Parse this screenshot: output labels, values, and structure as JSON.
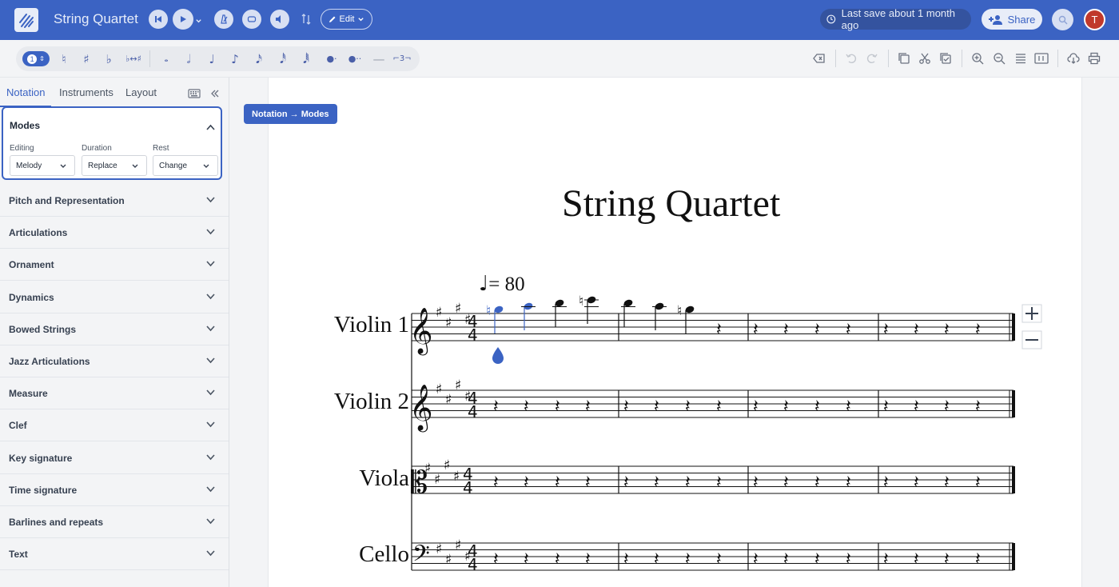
{
  "app": {
    "title": "String Quartet"
  },
  "header": {
    "edit_label": "Edit",
    "save_status": "Last save about 1 month ago",
    "share_label": "Share",
    "avatar_initial": "T"
  },
  "toolbar": {
    "voice_label": "1"
  },
  "sidebar": {
    "tabs": [
      {
        "label": "Notation"
      },
      {
        "label": "Instruments"
      },
      {
        "label": "Layout"
      }
    ],
    "modes": {
      "title": "Modes",
      "editing": {
        "label": "Editing",
        "value": "Melody"
      },
      "duration": {
        "label": "Duration",
        "value": "Replace"
      },
      "rest": {
        "label": "Rest",
        "value": "Change"
      }
    },
    "sections": [
      {
        "label": "Pitch and Representation"
      },
      {
        "label": "Articulations"
      },
      {
        "label": "Ornament"
      },
      {
        "label": "Dynamics"
      },
      {
        "label": "Bowed Strings"
      },
      {
        "label": "Jazz Articulations"
      },
      {
        "label": "Measure"
      },
      {
        "label": "Clef"
      },
      {
        "label": "Key signature"
      },
      {
        "label": "Time signature"
      },
      {
        "label": "Barlines and repeats"
      },
      {
        "label": "Text"
      }
    ]
  },
  "breadcrumb": "Notation → Modes",
  "score": {
    "title": "String Quartet",
    "tempo": "= 80",
    "instruments": [
      {
        "name": "Violin 1"
      },
      {
        "name": "Violin 2"
      },
      {
        "name": "Viola"
      },
      {
        "name": "Cello"
      }
    ]
  },
  "colors": {
    "accent": "#3b63c3",
    "selection": "#3b63c3"
  }
}
